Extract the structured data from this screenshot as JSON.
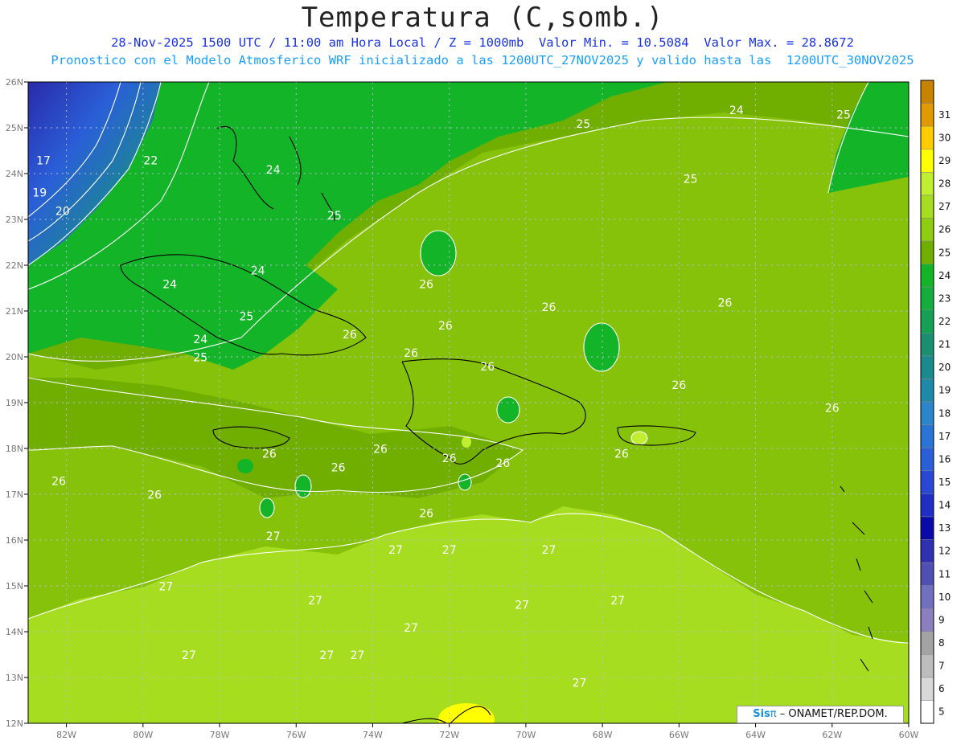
{
  "header": {
    "title": "Temperatura (C,somb.)",
    "subtitle_line1": "28-Nov-2025 1500 UTC / 11:00 am Hora Local / Z = 1000mb  Valor Min. = 10.5084  Valor Max. = 28.8672",
    "subtitle_line2": "Pronostico con el Modelo Atmosferico WRF inicializado a las 1200UTC_27NOV2025 y valido hasta las  1200UTC_30NOV2025"
  },
  "credit": {
    "brand": "Sis",
    "symbol": "π",
    "text": "– ONAMET/REP.DOM."
  },
  "chart_data": {
    "type": "heatmap",
    "variable": "Temperatura (C,somb.)",
    "level": "1000mb",
    "valid": "28-Nov-2025 1500 UTC",
    "min_value": 10.5084,
    "max_value": 28.8672,
    "x_axis": {
      "range": [
        -83,
        -60
      ],
      "ticks": [
        {
          "v": -82,
          "label": "82W"
        },
        {
          "v": -80,
          "label": "80W"
        },
        {
          "v": -78,
          "label": "78W"
        },
        {
          "v": -76,
          "label": "76W"
        },
        {
          "v": -74,
          "label": "74W"
        },
        {
          "v": -72,
          "label": "72W"
        },
        {
          "v": -70,
          "label": "70W"
        },
        {
          "v": -68,
          "label": "68W"
        },
        {
          "v": -66,
          "label": "66W"
        },
        {
          "v": -64,
          "label": "64W"
        },
        {
          "v": -62,
          "label": "62W"
        },
        {
          "v": -60,
          "label": "60W"
        }
      ]
    },
    "y_axis": {
      "range": [
        12,
        26
      ],
      "ticks": [
        {
          "v": 26,
          "label": "26N"
        },
        {
          "v": 25,
          "label": "25N"
        },
        {
          "v": 24,
          "label": "24N"
        },
        {
          "v": 23,
          "label": "23N"
        },
        {
          "v": 22,
          "label": "22N"
        },
        {
          "v": 21,
          "label": "21N"
        },
        {
          "v": 20,
          "label": "20N"
        },
        {
          "v": 19,
          "label": "19N"
        },
        {
          "v": 18,
          "label": "18N"
        },
        {
          "v": 17,
          "label": "17N"
        },
        {
          "v": 16,
          "label": "16N"
        },
        {
          "v": 15,
          "label": "15N"
        },
        {
          "v": 14,
          "label": "14N"
        },
        {
          "v": 13,
          "label": "13N"
        },
        {
          "v": 12,
          "label": "12N"
        }
      ]
    },
    "grid": true,
    "colorbar": {
      "position": "right",
      "levels": [
        {
          "label": "5",
          "color": "#ffffff"
        },
        {
          "label": "6",
          "color": "#d8d8d8"
        },
        {
          "label": "7",
          "color": "#bdbdbd"
        },
        {
          "label": "8",
          "color": "#a3a3a3"
        },
        {
          "label": "9",
          "color": "#8d7ebd"
        },
        {
          "label": "10",
          "color": "#7070bf"
        },
        {
          "label": "11",
          "color": "#5050b3"
        },
        {
          "label": "12",
          "color": "#3030b3"
        },
        {
          "label": "13",
          "color": "#0a0aa8"
        },
        {
          "label": "14",
          "color": "#1f2fc4"
        },
        {
          "label": "15",
          "color": "#2a47d6"
        },
        {
          "label": "16",
          "color": "#2a5fd8"
        },
        {
          "label": "17",
          "color": "#2a74d4"
        },
        {
          "label": "18",
          "color": "#2a86c8"
        },
        {
          "label": "19",
          "color": "#1f8aa8"
        },
        {
          "label": "20",
          "color": "#1a8a8c"
        },
        {
          "label": "21",
          "color": "#1a9070"
        },
        {
          "label": "22",
          "color": "#16a055"
        },
        {
          "label": "23",
          "color": "#14ae40"
        },
        {
          "label": "24",
          "color": "#14b428"
        },
        {
          "label": "25",
          "color": "#70ae00"
        },
        {
          "label": "26",
          "color": "#90cc10"
        },
        {
          "label": "27",
          "color": "#a6dd20"
        },
        {
          "label": "28",
          "color": "#c0ee30"
        },
        {
          "label": "29",
          "color": "#ffff00"
        },
        {
          "label": "30",
          "color": "#ffcc00"
        },
        {
          "label": "31",
          "color": "#e09a00"
        },
        {
          "label": "",
          "color": "#c88400"
        }
      ]
    },
    "contour_labels": [
      {
        "text": "17",
        "lon": -82.6,
        "lat": 24.2
      },
      {
        "text": "19",
        "lon": -82.7,
        "lat": 23.5
      },
      {
        "text": "20",
        "lon": -82.1,
        "lat": 23.1
      },
      {
        "text": "22",
        "lon": -79.8,
        "lat": 24.2
      },
      {
        "text": "24",
        "lon": -76.6,
        "lat": 24.0
      },
      {
        "text": "25",
        "lon": -75.0,
        "lat": 23.0
      },
      {
        "text": "24",
        "lon": -79.3,
        "lat": 21.5
      },
      {
        "text": "24",
        "lon": -77.0,
        "lat": 21.8
      },
      {
        "text": "24",
        "lon": -78.5,
        "lat": 20.3
      },
      {
        "text": "25",
        "lon": -77.3,
        "lat": 20.8
      },
      {
        "text": "25",
        "lon": -78.5,
        "lat": 19.9
      },
      {
        "text": "26",
        "lon": -74.6,
        "lat": 20.4
      },
      {
        "text": "26",
        "lon": -72.6,
        "lat": 21.5
      },
      {
        "text": "26",
        "lon": -72.1,
        "lat": 20.6
      },
      {
        "text": "26",
        "lon": -73.0,
        "lat": 20.0
      },
      {
        "text": "26",
        "lon": -71.0,
        "lat": 19.7
      },
      {
        "text": "26",
        "lon": -69.4,
        "lat": 21.0
      },
      {
        "text": "26",
        "lon": -64.8,
        "lat": 21.1
      },
      {
        "text": "26",
        "lon": -66.0,
        "lat": 19.3
      },
      {
        "text": "26",
        "lon": -62.0,
        "lat": 18.8
      },
      {
        "text": "26",
        "lon": -76.7,
        "lat": 17.8
      },
      {
        "text": "26",
        "lon": -74.9,
        "lat": 17.5
      },
      {
        "text": "26",
        "lon": -73.8,
        "lat": 17.9
      },
      {
        "text": "26",
        "lon": -72.0,
        "lat": 17.7
      },
      {
        "text": "26",
        "lon": -70.6,
        "lat": 17.6
      },
      {
        "text": "26",
        "lon": -67.5,
        "lat": 17.8
      },
      {
        "text": "26",
        "lon": -72.6,
        "lat": 16.5
      },
      {
        "text": "26",
        "lon": -82.2,
        "lat": 17.2
      },
      {
        "text": "26",
        "lon": -79.7,
        "lat": 16.9
      },
      {
        "text": "24",
        "lon": -64.5,
        "lat": 25.3
      },
      {
        "text": "25",
        "lon": -61.7,
        "lat": 25.2
      },
      {
        "text": "25",
        "lon": -68.5,
        "lat": 25.0
      },
      {
        "text": "25",
        "lon": -65.7,
        "lat": 23.8
      },
      {
        "text": "27",
        "lon": -76.6,
        "lat": 16.0
      },
      {
        "text": "27",
        "lon": -73.4,
        "lat": 15.7
      },
      {
        "text": "27",
        "lon": -72.0,
        "lat": 15.7
      },
      {
        "text": "27",
        "lon": -69.4,
        "lat": 15.7
      },
      {
        "text": "27",
        "lon": -79.4,
        "lat": 14.9
      },
      {
        "text": "27",
        "lon": -75.5,
        "lat": 14.6
      },
      {
        "text": "27",
        "lon": -70.1,
        "lat": 14.5
      },
      {
        "text": "27",
        "lon": -67.6,
        "lat": 14.6
      },
      {
        "text": "27",
        "lon": -73.0,
        "lat": 14.0
      },
      {
        "text": "27",
        "lon": -78.8,
        "lat": 13.4
      },
      {
        "text": "27",
        "lon": -75.2,
        "lat": 13.4
      },
      {
        "text": "27",
        "lon": -74.4,
        "lat": 13.4
      },
      {
        "text": "27",
        "lon": -68.6,
        "lat": 12.8
      }
    ]
  }
}
